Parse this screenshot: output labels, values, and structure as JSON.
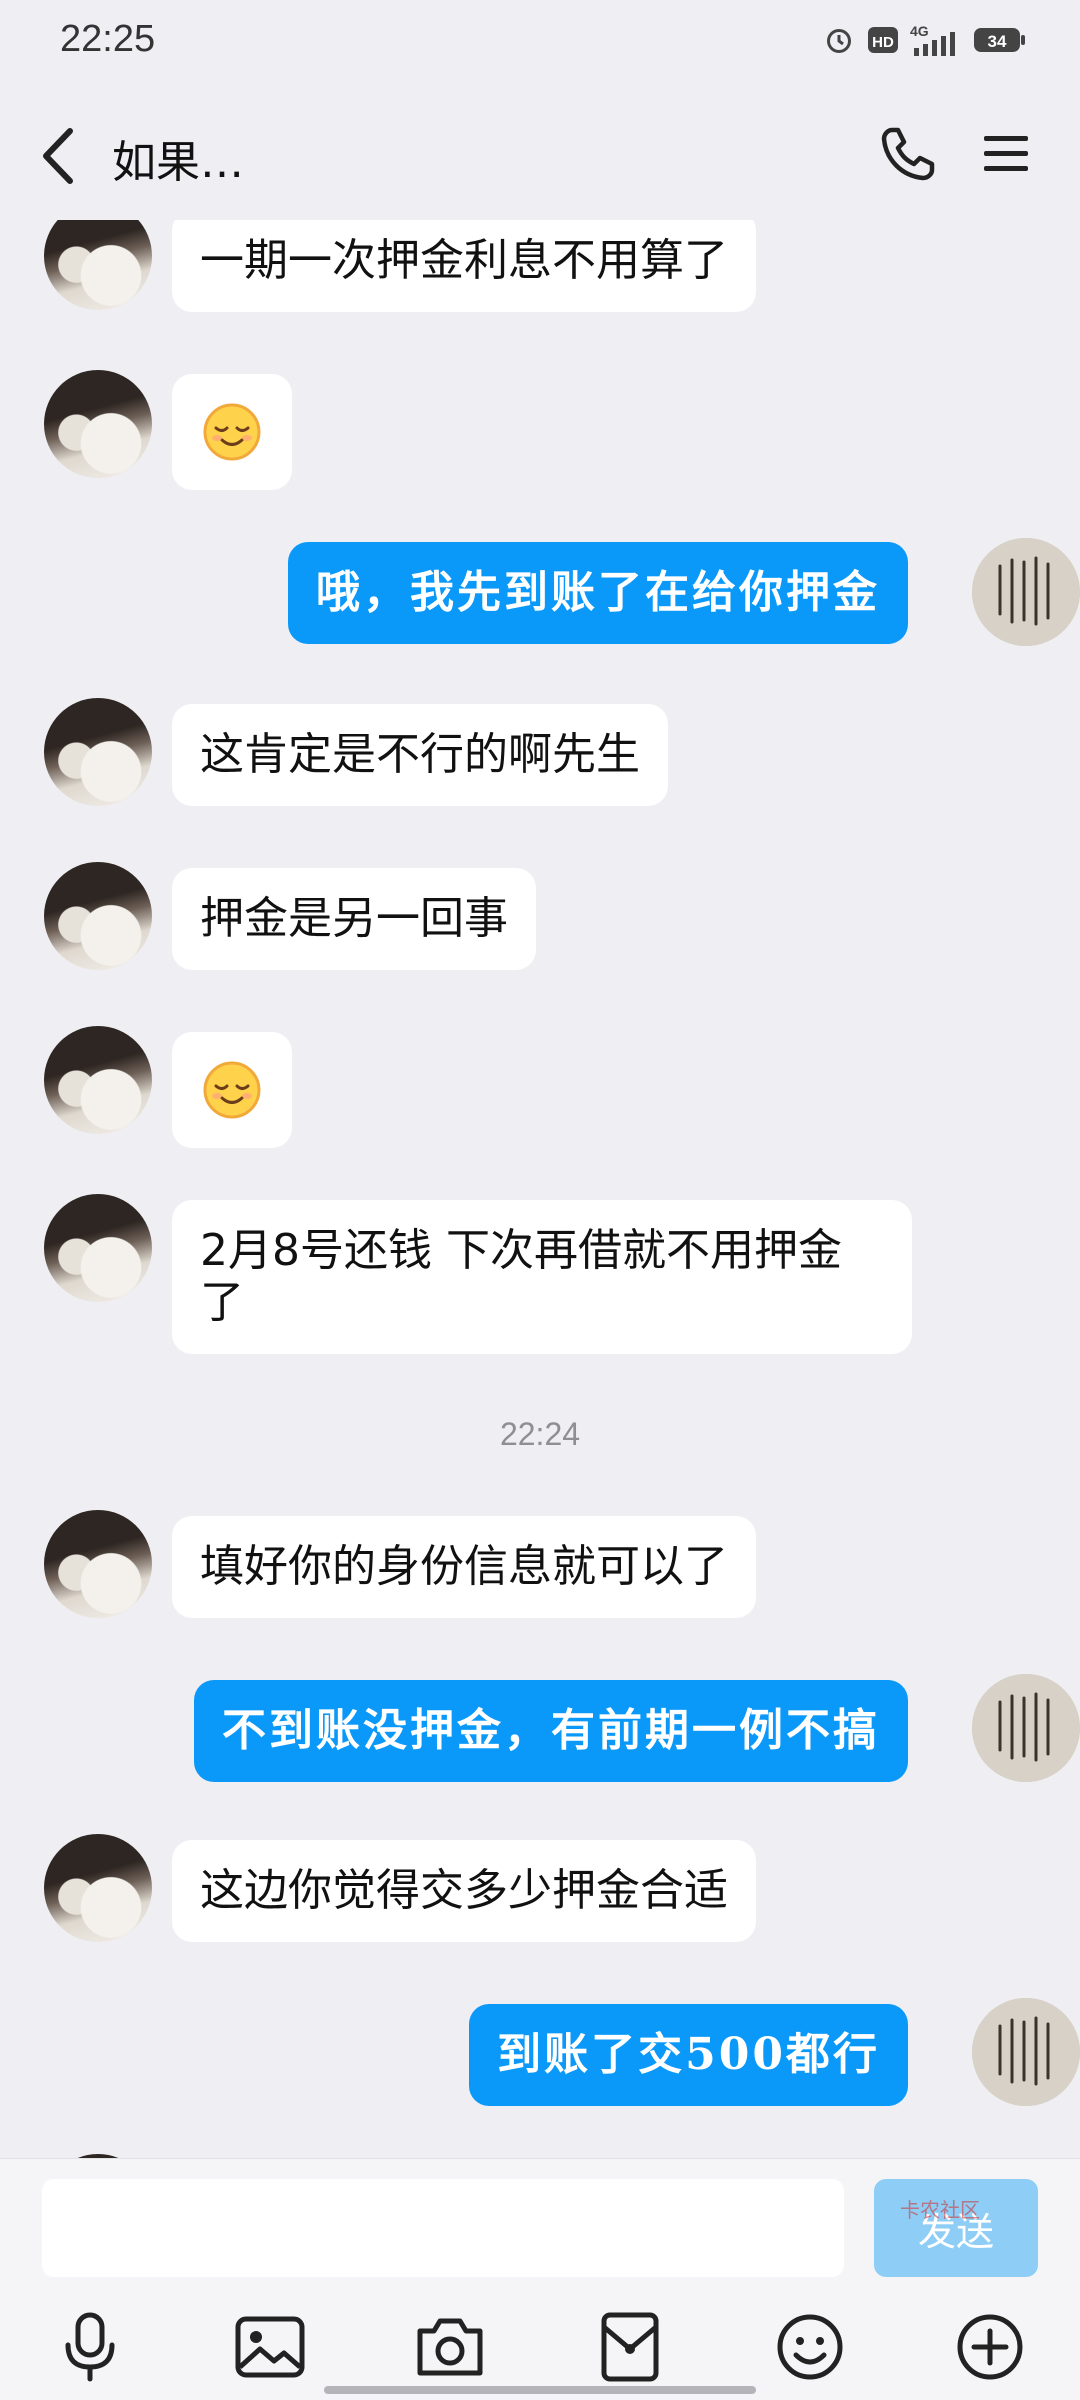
{
  "status_bar": {
    "time": "22:25",
    "network": "4G",
    "battery": "34"
  },
  "header": {
    "title": "如果…"
  },
  "messages": [
    {
      "side": "in",
      "text": "一期一次押金利息不用算了"
    },
    {
      "side": "in",
      "emoji": "smiling-face"
    },
    {
      "side": "out",
      "text": "哦，我先到账了在给你押金"
    },
    {
      "side": "in",
      "text": "这肯定是不行的啊先生"
    },
    {
      "side": "in",
      "text": "押金是另一回事"
    },
    {
      "side": "in",
      "emoji": "smiling-face"
    },
    {
      "side": "in",
      "text_line1": "2月8号还钱 下次再借就不用押金",
      "text_line2": "了"
    },
    {
      "side": "in",
      "text": "填好你的身份信息就可以了"
    },
    {
      "side": "out",
      "text": "不到账没押金，有前期一例不搞"
    },
    {
      "side": "in",
      "text": "这边你觉得交多少押金合适"
    },
    {
      "side": "out",
      "text": "到账了交500都行"
    }
  ],
  "time_divider": "22:24",
  "input": {
    "placeholder": "",
    "send_label": "发送"
  },
  "watermark": "卡农社区",
  "colors": {
    "outgoing_bubble": "#0b99f9",
    "incoming_bubble": "#ffffff",
    "background": "#eeeef3",
    "send_button_disabled": "#8ecdf5"
  }
}
